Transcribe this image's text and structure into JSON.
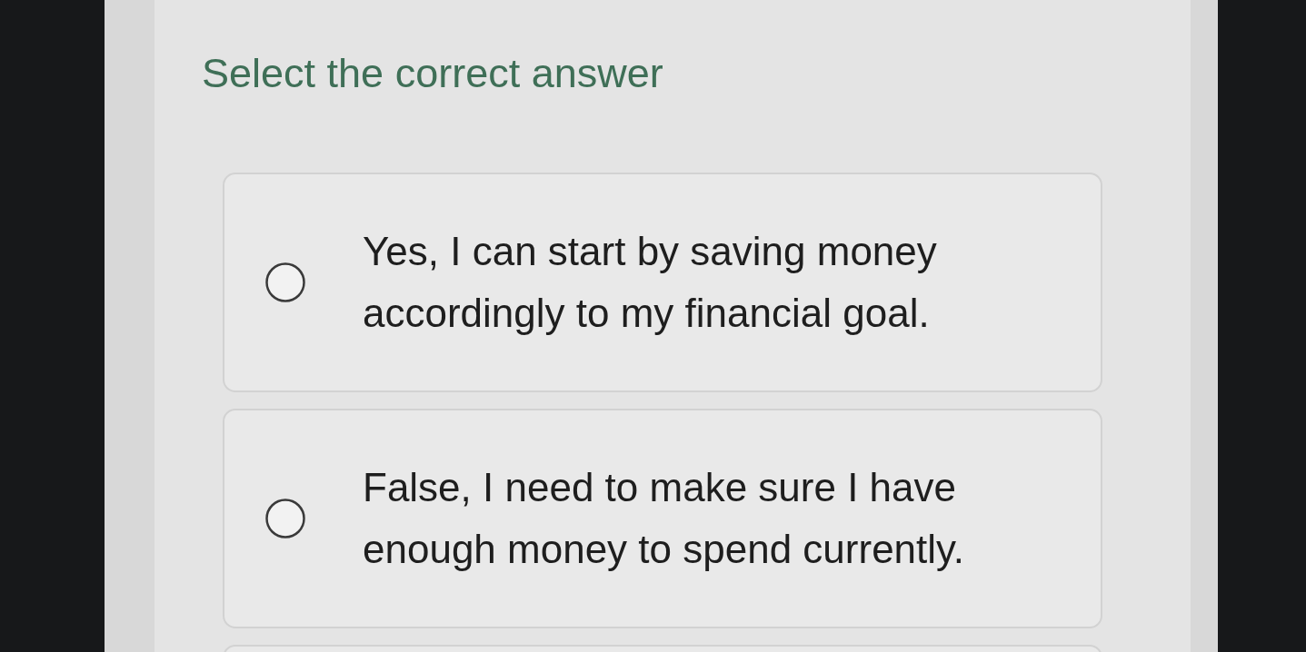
{
  "question": {
    "prompt": "Select the correct answer"
  },
  "options": [
    {
      "text": "Yes, I can start by saving money accordingly to my financial goal.",
      "selected": false
    },
    {
      "text": "False, I need to make sure I have enough money to spend currently.",
      "selected": false
    }
  ]
}
